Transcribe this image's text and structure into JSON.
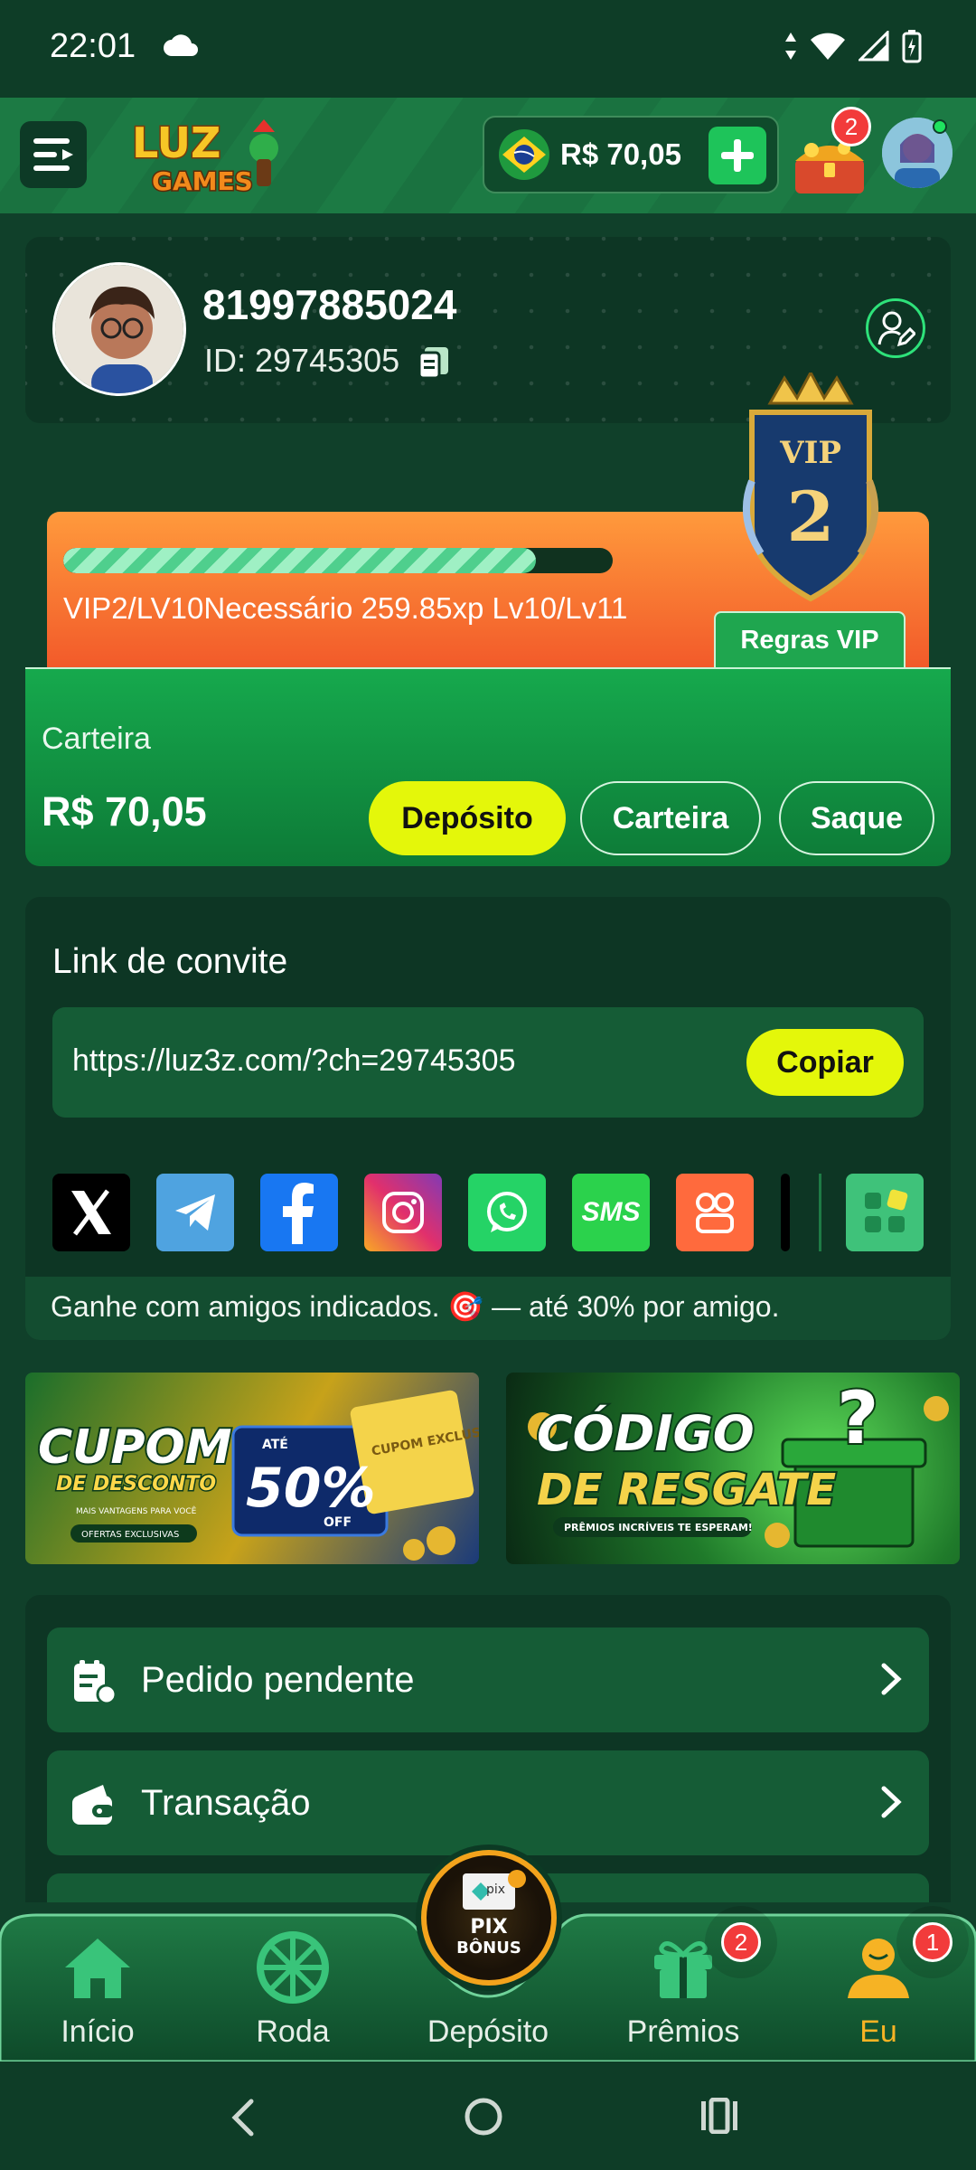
{
  "status_bar": {
    "time": "22:01"
  },
  "header": {
    "logo_line1": "LUZ",
    "logo_line2": "GAMES",
    "balance": "R$ 70,05",
    "rewards_badge": "2"
  },
  "profile": {
    "username": "81997885024",
    "user_id": "ID: 29745305"
  },
  "vip": {
    "progress": 0.86,
    "status_text": "VIP2/LV10Necessário 259.85xp Lv10/Lv11",
    "rules_button": "Regras VIP",
    "emblem_label": "VIP",
    "emblem_level": "2"
  },
  "wallet": {
    "label": "Carteira",
    "amount": "R$ 70,05",
    "deposit_button": "Depósito",
    "wallet_button": "Carteira",
    "withdraw_button": "Saque"
  },
  "invite": {
    "title": "Link de convite",
    "url": "https://luz3z.com/?ch=29745305",
    "copy_button": "Copiar",
    "share_sms": "SMS",
    "footer_text": "Ganhe com amigos indicados. 🎯 — até 30% por amigo."
  },
  "banners": {
    "coupon_title_line1": "CUPOM",
    "coupon_title_line2": "DE DESCONTO",
    "coupon_small": "MAIS VANTAGENS PARA VOCÊ",
    "coupon_offers": "OFERTAS EXCLUSIVAS",
    "coupon_upto": "ATÉ",
    "coupon_percent": "50%",
    "coupon_off": "OFF",
    "coupon_ticket": "CUPOM EXCLUSIVO",
    "code_title_line1": "CÓDIGO",
    "code_title_line2": "DE RESGATE",
    "code_small": "PRÊMIOS INCRÍVEIS TE ESPERAM!"
  },
  "menu": {
    "items": [
      {
        "label": "Pedido pendente"
      },
      {
        "label": "Transação"
      }
    ]
  },
  "bottom_nav": {
    "home": "Início",
    "wheel": "Roda",
    "deposit": "Depósito",
    "prizes": "Prêmios",
    "prizes_badge": "2",
    "me": "Eu",
    "me_badge": "1",
    "pix_label": "PIX",
    "pix_bonus": "BÔNUS",
    "pix_small": "pix"
  },
  "colors": {
    "background": "#10402a",
    "card": "#0d3624",
    "accent_yellow": "#e4f70a",
    "accent_green": "#1ec45a",
    "active_nav": "#f6b324"
  }
}
